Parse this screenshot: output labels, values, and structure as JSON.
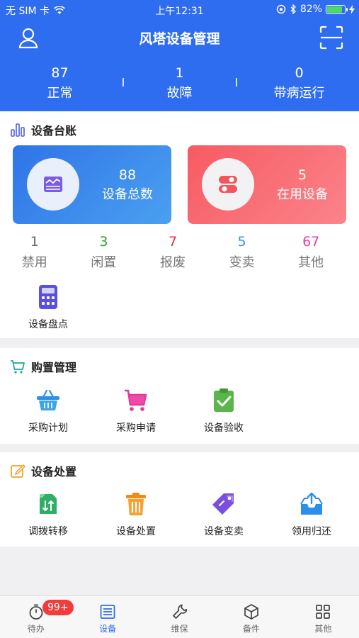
{
  "status_bar": {
    "carrier": "无 SIM 卡",
    "time": "上午12:31",
    "battery": "82%",
    "battery_level": 0.82
  },
  "header": {
    "title": "风塔设备管理"
  },
  "summary": [
    {
      "value": "87",
      "label": "正常"
    },
    {
      "value": "1",
      "label": "故障"
    },
    {
      "value": "0",
      "label": "带病运行"
    }
  ],
  "ledger": {
    "title": "设备台账",
    "cards": [
      {
        "value": "88",
        "label": "设备总数"
      },
      {
        "value": "5",
        "label": "在用设备"
      }
    ],
    "statuses": [
      {
        "value": "1",
        "label": "禁用",
        "color": "#666666"
      },
      {
        "value": "3",
        "label": "闲置",
        "color": "#2aa52a"
      },
      {
        "value": "7",
        "label": "报废",
        "color": "#e8303a"
      },
      {
        "value": "5",
        "label": "变卖",
        "color": "#3b8fe8"
      },
      {
        "value": "67",
        "label": "其他",
        "color": "#e83ea0"
      }
    ],
    "inventory_label": "设备盘点"
  },
  "purchase": {
    "title": "购置管理",
    "items": [
      {
        "label": "采购计划",
        "icon": "basket-icon"
      },
      {
        "label": "采购申请",
        "icon": "cart-icon"
      },
      {
        "label": "设备验收",
        "icon": "clipboard-check-icon"
      }
    ]
  },
  "disposal": {
    "title": "设备处置",
    "items": [
      {
        "label": "调拨转移",
        "icon": "transfer-icon"
      },
      {
        "label": "设备处置",
        "icon": "trash-icon"
      },
      {
        "label": "设备变卖",
        "icon": "tag-icon"
      },
      {
        "label": "领用归还",
        "icon": "inbox-return-icon"
      }
    ]
  },
  "tabbar": {
    "badge": "99+",
    "tabs": [
      {
        "label": "待办",
        "icon": "stopwatch-icon"
      },
      {
        "label": "设备",
        "icon": "device-icon",
        "active": true
      },
      {
        "label": "维保",
        "icon": "wrench-icon"
      },
      {
        "label": "备件",
        "icon": "cube-icon"
      },
      {
        "label": "其他",
        "icon": "grid-icon"
      }
    ]
  },
  "colors": {
    "primary": "#2f6df0",
    "card_blue": "#3b86ea",
    "card_red": "#f96b72",
    "badge": "#f23b3b"
  }
}
